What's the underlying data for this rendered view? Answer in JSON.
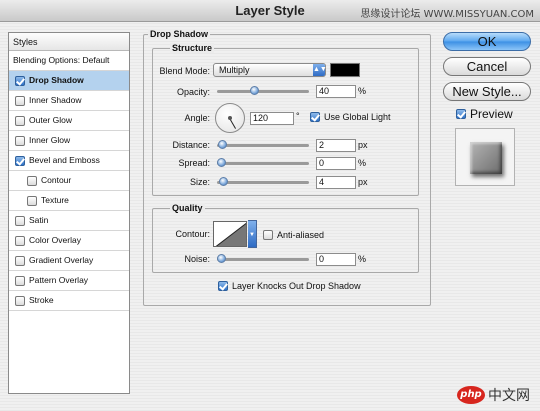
{
  "window": {
    "title": "Layer Style",
    "watermark": "思缘设计论坛 WWW.MISSYUAN.COM"
  },
  "left_panel": {
    "header": "Styles",
    "items": [
      {
        "label": "Blending Options: Default",
        "checkbox": false,
        "checked": false,
        "selected": false,
        "indent": false
      },
      {
        "label": "Drop Shadow",
        "checkbox": true,
        "checked": true,
        "selected": true,
        "indent": false
      },
      {
        "label": "Inner Shadow",
        "checkbox": true,
        "checked": false,
        "selected": false,
        "indent": false
      },
      {
        "label": "Outer Glow",
        "checkbox": true,
        "checked": false,
        "selected": false,
        "indent": false
      },
      {
        "label": "Inner Glow",
        "checkbox": true,
        "checked": false,
        "selected": false,
        "indent": false
      },
      {
        "label": "Bevel and Emboss",
        "checkbox": true,
        "checked": true,
        "selected": false,
        "indent": false
      },
      {
        "label": "Contour",
        "checkbox": true,
        "checked": false,
        "selected": false,
        "indent": true
      },
      {
        "label": "Texture",
        "checkbox": true,
        "checked": false,
        "selected": false,
        "indent": true
      },
      {
        "label": "Satin",
        "checkbox": true,
        "checked": false,
        "selected": false,
        "indent": false
      },
      {
        "label": "Color Overlay",
        "checkbox": true,
        "checked": false,
        "selected": false,
        "indent": false
      },
      {
        "label": "Gradient Overlay",
        "checkbox": true,
        "checked": false,
        "selected": false,
        "indent": false
      },
      {
        "label": "Pattern Overlay",
        "checkbox": true,
        "checked": false,
        "selected": false,
        "indent": false
      },
      {
        "label": "Stroke",
        "checkbox": true,
        "checked": false,
        "selected": false,
        "indent": false
      }
    ]
  },
  "drop_shadow": {
    "title": "Drop Shadow",
    "structure": {
      "title": "Structure",
      "blend_mode_label": "Blend Mode:",
      "blend_mode_value": "Multiply",
      "shadow_color": "#000000",
      "opacity_label": "Opacity:",
      "opacity_value": "40",
      "opacity_unit": "%",
      "opacity_fraction": 0.4,
      "angle_label": "Angle:",
      "angle_value": "120",
      "angle_unit": "°",
      "use_global_light_label": "Use Global Light",
      "use_global_light_checked": true,
      "distance_label": "Distance:",
      "distance_value": "2",
      "distance_unit": "px",
      "distance_fraction": 0.01,
      "spread_label": "Spread:",
      "spread_value": "0",
      "spread_unit": "%",
      "spread_fraction": 0,
      "size_label": "Size:",
      "size_value": "4",
      "size_unit": "px",
      "size_fraction": 0.02
    },
    "quality": {
      "title": "Quality",
      "contour_label": "Contour:",
      "anti_aliased_label": "Anti-aliased",
      "anti_aliased_checked": false,
      "noise_label": "Noise:",
      "noise_value": "0",
      "noise_unit": "%",
      "noise_fraction": 0
    },
    "knocks_out_label": "Layer Knocks Out Drop Shadow",
    "knocks_out_checked": true
  },
  "buttons": {
    "ok": "OK",
    "cancel": "Cancel",
    "new_style": "New Style..."
  },
  "preview": {
    "label": "Preview",
    "checked": true
  },
  "logo": {
    "mark": "php",
    "text": "中文网"
  }
}
